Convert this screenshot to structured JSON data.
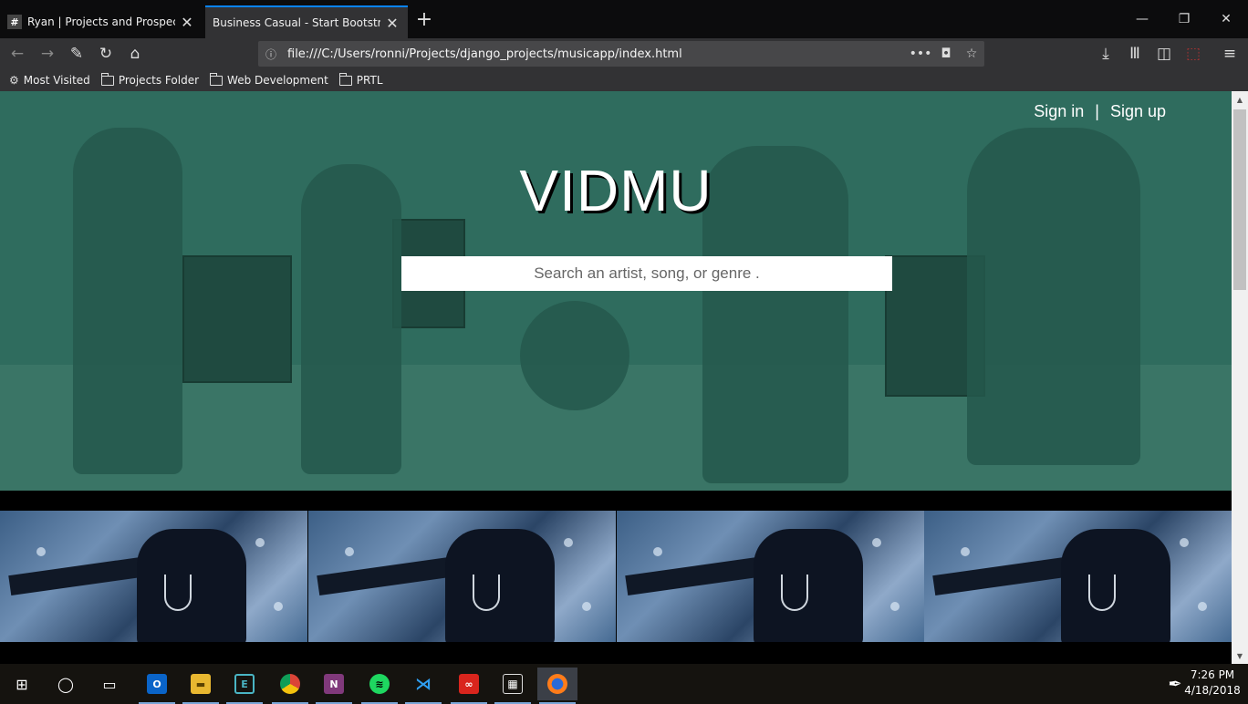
{
  "browser": {
    "tabs": [
      {
        "label": "Ryan | Projects and Prospects S",
        "favicon": "#",
        "active": false
      },
      {
        "label": "Business Casual - Start Bootstrap Th",
        "favicon": "",
        "active": true
      }
    ],
    "url": "file:///C:/Users/ronni/Projects/django_projects/musicapp/index.html",
    "bookmarks": [
      "Most Visited",
      "Projects Folder",
      "Web Development",
      "PRTL"
    ]
  },
  "site": {
    "brand": "VIDMU",
    "sign_in": "Sign in",
    "separator": "|",
    "sign_up": "Sign up",
    "search_placeholder": "Search an artist, song, or genre ."
  },
  "colors": {
    "hero_overlay": "#2f6c5e",
    "active_tab_accent": "#0a84ff"
  },
  "taskbar": {
    "time": "7:26 PM",
    "date": "4/18/2018",
    "apps": [
      "start-icon",
      "cortana-icon",
      "task-view-icon",
      "outlook-icon",
      "file-explorer-icon",
      "terminal-icon",
      "chrome-icon",
      "onenote-icon",
      "spotify-icon",
      "vscode-icon",
      "creative-cloud-icon",
      "calculator-icon",
      "firefox-icon"
    ]
  }
}
